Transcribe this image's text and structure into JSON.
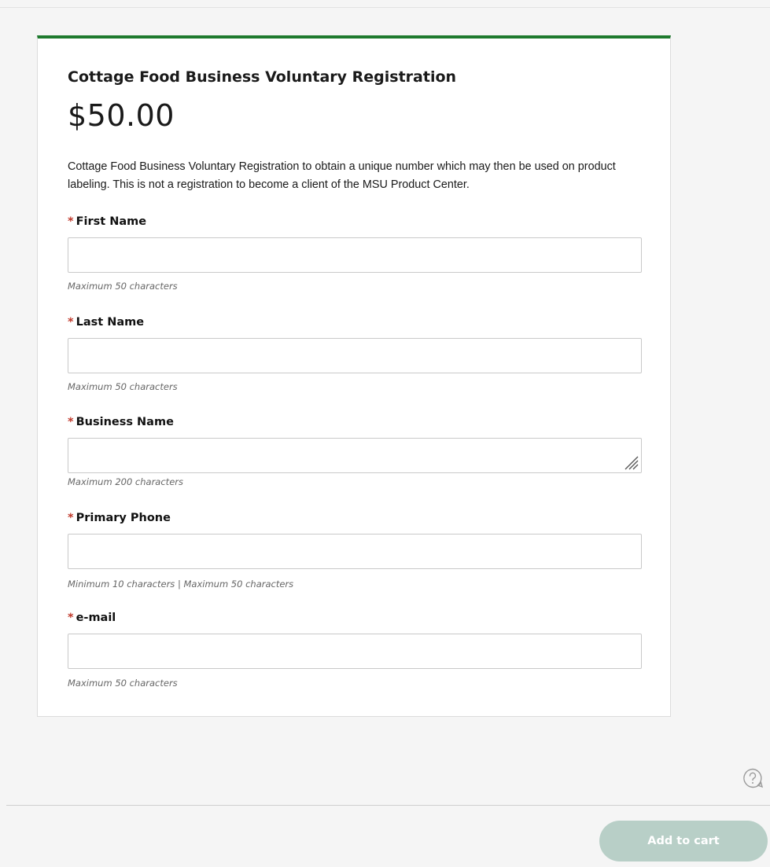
{
  "product": {
    "title": "Cottage Food Business Voluntary Registration",
    "price": "$50.00",
    "description": "Cottage Food Business Voluntary Registration to obtain a unique number which may then be used on product labeling. This is not a registration to become a client of the MSU Product Center."
  },
  "form": {
    "required_marker": "*",
    "fields": [
      {
        "label": "First Name",
        "value": "",
        "hint": "Maximum 50 characters",
        "type": "input"
      },
      {
        "label": "Last Name",
        "value": "",
        "hint": "Maximum 50 characters",
        "type": "input"
      },
      {
        "label": "Business Name",
        "value": "",
        "hint": "Maximum 200 characters",
        "type": "textarea"
      },
      {
        "label": "Primary Phone",
        "value": "",
        "hint": "Minimum 10 characters | Maximum 50 characters",
        "type": "input"
      },
      {
        "label": "e-mail",
        "value": "",
        "hint": "Maximum 50 characters",
        "type": "input"
      }
    ]
  },
  "footer": {
    "add_to_cart_label": "Add to cart",
    "help_icon": "question-circle-icon"
  },
  "colors": {
    "accent_green": "#1e7a2e",
    "required_red": "#c0392b",
    "button_disabled": "#b8cfc7"
  }
}
